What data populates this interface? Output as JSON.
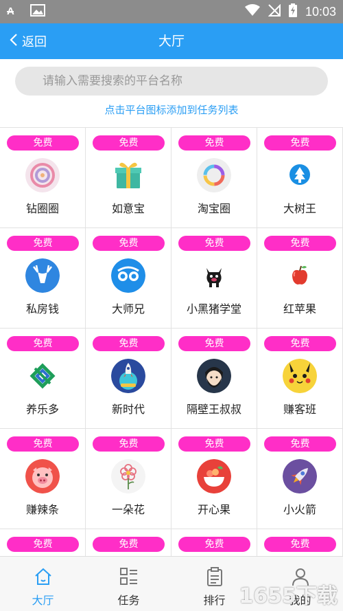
{
  "status_bar": {
    "time": "10:03",
    "left_icons": [
      "font-icon",
      "image-icon"
    ],
    "right_icons": [
      "wifi-icon",
      "no-signal-icon",
      "battery-charging-icon"
    ]
  },
  "nav": {
    "back_label": "返回",
    "title": "大厅"
  },
  "search": {
    "placeholder": "请输入需要搜索的平台名称"
  },
  "hint_text": "点击平台图标添加到任务列表",
  "colors": {
    "accent": "#2a9ef4",
    "badge": "#ff2ec7",
    "status_bar": "#8c8c8c"
  },
  "apps": [
    {
      "badge": "免费",
      "name": "钻圈圈",
      "icon": "swirl-icon"
    },
    {
      "badge": "免费",
      "name": "如意宝",
      "icon": "gift-box-icon"
    },
    {
      "badge": "免费",
      "name": "淘宝圈",
      "icon": "rainbow-ring-icon"
    },
    {
      "badge": "免费",
      "name": "大树王",
      "icon": "tree-icon"
    },
    {
      "badge": "免费",
      "name": "私房钱",
      "icon": "deer-icon"
    },
    {
      "badge": "免费",
      "name": "大师兄",
      "icon": "goggles-icon"
    },
    {
      "badge": "免费",
      "name": "小黑猪学堂",
      "icon": "black-pig-icon"
    },
    {
      "badge": "免费",
      "name": "红苹果",
      "icon": "red-apple-icon"
    },
    {
      "badge": "免费",
      "name": "养乐多",
      "icon": "green-knot-icon"
    },
    {
      "badge": "免费",
      "name": "新时代",
      "icon": "rocket-planet-icon"
    },
    {
      "badge": "免费",
      "name": "隔壁王叔叔",
      "icon": "bearded-man-icon"
    },
    {
      "badge": "免费",
      "name": "赚客班",
      "icon": "pikachu-icon"
    },
    {
      "badge": "免费",
      "name": "赚辣条",
      "icon": "pig-face-icon"
    },
    {
      "badge": "免费",
      "name": "一朵花",
      "icon": "flower-icon"
    },
    {
      "badge": "免费",
      "name": "开心果",
      "icon": "fruit-bowl-icon"
    },
    {
      "badge": "免费",
      "name": "小火箭",
      "icon": "rocket-icon"
    },
    {
      "badge": "免费",
      "name": "",
      "icon": ""
    },
    {
      "badge": "免费",
      "name": "",
      "icon": ""
    },
    {
      "badge": "免费",
      "name": "",
      "icon": ""
    },
    {
      "badge": "免费",
      "name": "",
      "icon": ""
    }
  ],
  "tabs": [
    {
      "label": "大厅",
      "icon": "home-icon",
      "active": true
    },
    {
      "label": "任务",
      "icon": "task-list-icon",
      "active": false
    },
    {
      "label": "排行",
      "icon": "clipboard-icon",
      "active": false
    },
    {
      "label": "我的",
      "icon": "user-icon",
      "active": false
    }
  ],
  "watermark": "1655下载"
}
